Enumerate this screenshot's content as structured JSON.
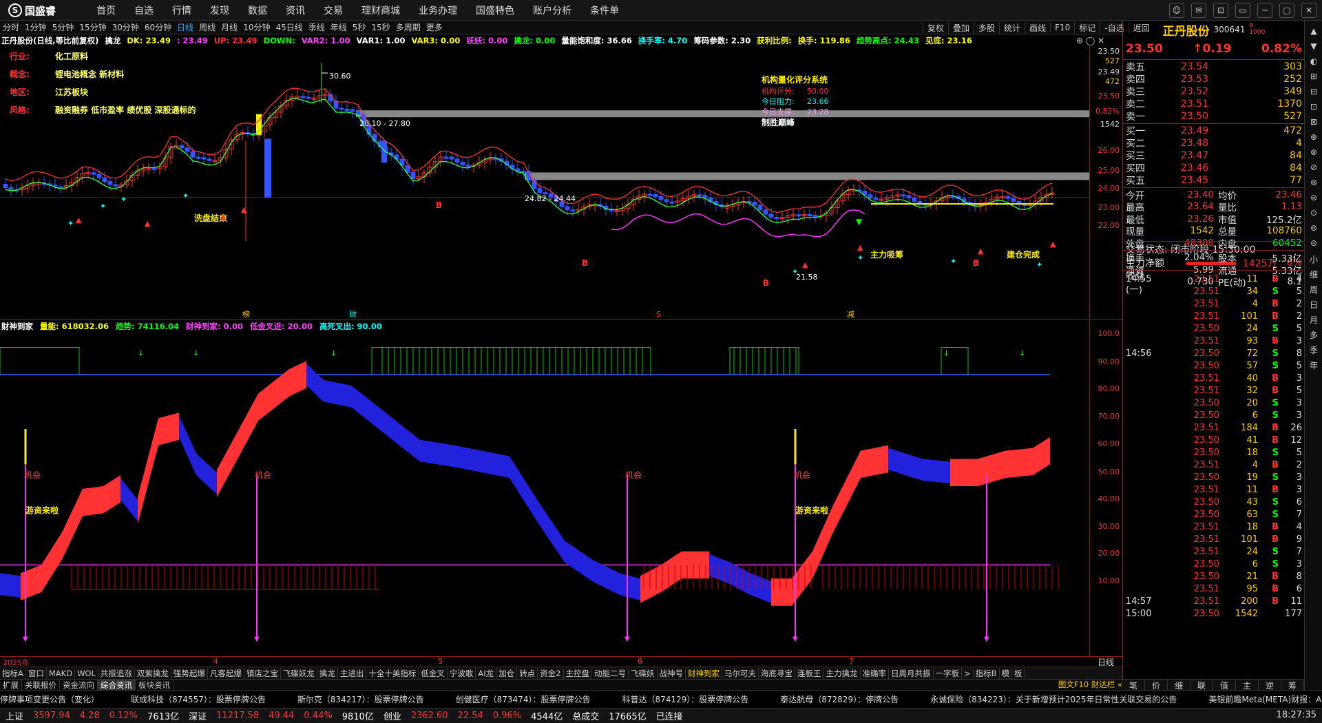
{
  "brand": {
    "name": "国盛睿"
  },
  "menu": [
    "首页",
    "自选",
    "行情",
    "发现",
    "数据",
    "资讯",
    "交易",
    "理财商城",
    "业务办理",
    "国盛特色",
    "账户分析",
    "条件单"
  ],
  "window_controls": [
    "☺",
    "✉",
    "⊡",
    "▭",
    "─",
    "▢",
    "✕"
  ],
  "periods": [
    "分时",
    "1分钟",
    "5分钟",
    "15分钟",
    "30分钟",
    "60分钟",
    "日线",
    "周线",
    "月线",
    "10分钟",
    "45日线",
    "季线",
    "年线",
    "5秒",
    "15秒",
    "多周期",
    "更多"
  ],
  "active_period": "日线",
  "right_tools": [
    "复权",
    "叠加",
    "多股",
    "统计",
    "画线",
    "F10",
    "标记",
    "-自选",
    "返回"
  ],
  "chart_info": [
    {
      "t": "正丹股份(日线,等比前复权)",
      "c": "#ffffff"
    },
    {
      "t": "擒龙",
      "c": "#ffffff"
    },
    {
      "t": "DK: 23.49",
      "c": "#ffff00"
    },
    {
      "t": ": 23.49",
      "c": "#ff44ff"
    },
    {
      "t": "UP: 23.49",
      "c": "#ff3333"
    },
    {
      "t": "DOWN: ",
      "c": "#00ff00"
    },
    {
      "t": "VAR2: 1.00",
      "c": "#ff44ff"
    },
    {
      "t": "VAR1: 1.00",
      "c": "#ffffff"
    },
    {
      "t": "VAR3: 0.00",
      "c": "#ffff00"
    },
    {
      "t": "妖妖: 0.00",
      "c": "#ff44ff"
    },
    {
      "t": "擒龙: 0.00",
      "c": "#00ff00"
    },
    {
      "t": "量能饱和度: 36.66",
      "c": "#ffffff"
    },
    {
      "t": "换手率: 4.70",
      "c": "#00ffff"
    },
    {
      "t": "筹码参数: 2.30",
      "c": "#ffffff"
    },
    {
      "t": "获利比例: ",
      "c": "#ffff00"
    },
    {
      "t": "换手: 119.86",
      "c": "#ffff00"
    },
    {
      "t": "趋势高点: 24.43",
      "c": "#00ff00"
    },
    {
      "t": "见底: 23.16",
      "c": "#ffff00"
    }
  ],
  "close_buttons": "⊕ ◯ ✕",
  "stock_tags": [
    {
      "k": "行业:",
      "v": "化工原料"
    },
    {
      "k": "概念:",
      "v": "锂电池概念 新材料"
    },
    {
      "k": "地区:",
      "v": "江苏板块"
    },
    {
      "k": "风格:",
      "v": "融资融券 低市盈率 绩优股 深股通标的"
    }
  ],
  "score_box": {
    "title": "机构量化评分系统",
    "lines": [
      {
        "k": "机构评分:",
        "v": "50.00",
        "c": "#ff3333"
      },
      {
        "k": "今日阻力:",
        "v": "23.66",
        "c": "#00ffff"
      },
      {
        "k": "今日支撑:",
        "v": "23.28",
        "c": "#ff99ff"
      }
    ],
    "footer": "制胜巅峰"
  },
  "annotations": {
    "high": "30.60",
    "zone1": "28.10 - 27.80",
    "zone2": "24.82 - 24.44",
    "low": "21.58",
    "wash": "洗盘结束",
    "main_absorb": "主力吸筹",
    "build_done": "建仓完成",
    "b": "B",
    "s": "S",
    "bang": "榜",
    "cai": "财",
    "jian": "减"
  },
  "main_axis": {
    "top_labels": [
      "23.50",
      "527",
      "23.49",
      "472",
      "23.50",
      "0.82%",
      "1542"
    ],
    "prices": [
      "26.00",
      "25.00",
      "24.00",
      "23.00",
      "22.00"
    ]
  },
  "indicator_info": [
    {
      "t": "财神到家",
      "c": "#ffffff"
    },
    {
      "t": "量能: 618032.06",
      "c": "#ffff00"
    },
    {
      "t": "趋势: 74116.04",
      "c": "#00ff00"
    },
    {
      "t": "财神到家: 0.00",
      "c": "#ff44ff"
    },
    {
      "t": "低金叉进: 20.00",
      "c": "#ff44ff"
    },
    {
      "t": "高死叉出: 90.00",
      "c": "#00ffff"
    }
  ],
  "ind_axis": [
    "100.0",
    "90.00",
    "80.00",
    "70.00",
    "60.00",
    "50.00",
    "40.00",
    "30.00",
    "20.00",
    "10.00"
  ],
  "ind_labels": {
    "chance": "机会",
    "fund": "游资来啦"
  },
  "dates": [
    "2025年",
    "4",
    "5",
    "6",
    "7"
  ],
  "day_label": "日线",
  "indicator_tabs": [
    "指标A",
    "窗口",
    "MAKD",
    "WOL",
    "共振追涨",
    "双紫擒龙",
    "强势起爆",
    "凡客起爆",
    "镇店之宝",
    "飞碟妖龙",
    "擒龙",
    "主进出",
    "十全十美指标",
    "低金叉",
    "宁波敢",
    "AI龙",
    "加仓",
    "转点",
    "资金2",
    "主控盘",
    "动能二号",
    "飞碟妖",
    "战神号",
    "财神到家",
    "马尔可夫",
    "海底寻宝",
    "连板王",
    "主力擒龙",
    "准确率",
    "日周月共振",
    "一字板",
    ">",
    "指标B",
    "模",
    "板"
  ],
  "active_indicator": "财神到家",
  "sub_tabs": [
    "扩展",
    "关联报价",
    "资金流向",
    "综合资讯",
    "板块资讯"
  ],
  "active_sub": "综合资讯",
  "sub_right": "图文F10 财达栏 «",
  "ticker": [
    "停牌事项变更公告（变化）",
    "联成科技（874557）：股票停牌公告",
    "斯尔克（834217）：股票停牌公告",
    "创健医疗（873474）：股票停牌公告",
    "科普达（874129）：股票停牌公告",
    "泰达航母（872829）：停牌公告",
    "永诚保险（834223）：关于新增预计2025年日常性关联交易的公告",
    "美银前瞻Meta(META)财报：AI加持广告县"
  ],
  "status": [
    {
      "t": "上证",
      "c": "#ffffff"
    },
    {
      "t": "3597.94",
      "c": "#ff3333"
    },
    {
      "t": "4.28",
      "c": "#ff3333"
    },
    {
      "t": "0.12%",
      "c": "#ff3333"
    },
    {
      "t": "7613亿",
      "c": "#ffffff"
    },
    {
      "t": "深证",
      "c": "#ffffff"
    },
    {
      "t": "11217.58",
      "c": "#ff3333"
    },
    {
      "t": "49.44",
      "c": "#ff3333"
    },
    {
      "t": "0.44%",
      "c": "#ff3333"
    },
    {
      "t": "9810亿",
      "c": "#ffffff"
    },
    {
      "t": "创业",
      "c": "#ffffff"
    },
    {
      "t": "2362.60",
      "c": "#ff3333"
    },
    {
      "t": "22.54",
      "c": "#ff3333"
    },
    {
      "t": "0.96%",
      "c": "#ff3333"
    },
    {
      "t": "4544亿",
      "c": "#ffffff"
    },
    {
      "t": "总成交",
      "c": "#ffffff"
    },
    {
      "t": "17665亿",
      "c": "#ffffff"
    },
    {
      "t": "已连接",
      "c": "#ffffff"
    }
  ],
  "clock": "18:27:35",
  "panel": {
    "name": "正丹股份",
    "code": "300641",
    "price": "23.50",
    "change": "↑0.19",
    "pct": "0.82%",
    "asks": [
      {
        "l": "卖五",
        "p": "23.54",
        "v": "303"
      },
      {
        "l": "卖四",
        "p": "23.53",
        "v": "252"
      },
      {
        "l": "卖三",
        "p": "23.52",
        "v": "349"
      },
      {
        "l": "卖二",
        "p": "23.51",
        "v": "1370"
      },
      {
        "l": "卖一",
        "p": "23.50",
        "v": "527"
      }
    ],
    "bids": [
      {
        "l": "买一",
        "p": "23.49",
        "v": "472"
      },
      {
        "l": "买二",
        "p": "23.48",
        "v": "4"
      },
      {
        "l": "买三",
        "p": "23.47",
        "v": "84"
      },
      {
        "l": "买四",
        "p": "23.46",
        "v": "84"
      },
      {
        "l": "买五",
        "p": "23.45",
        "v": "77"
      }
    ],
    "quote": [
      {
        "a": "今开",
        "b": "23.40",
        "bc": "#ff3333",
        "c": "均价",
        "d": "23.46",
        "dc": "#ff3333"
      },
      {
        "a": "最高",
        "b": "23.64",
        "bc": "#ff3333",
        "c": "量比",
        "d": "1.13",
        "dc": "#ff3333"
      },
      {
        "a": "最低",
        "b": "23.26",
        "bc": "#ff3333",
        "c": "市值",
        "d": "125.2亿",
        "dc": "#dddddd"
      },
      {
        "a": "现量",
        "b": "1542",
        "bc": "#ffcc00",
        "c": "总量",
        "d": "108760",
        "dc": "#ffcc00"
      },
      {
        "a": "外盘",
        "b": "48308",
        "bc": "#ff3333",
        "c": "内盘",
        "d": "60452",
        "dc": "#00ff00"
      },
      {
        "a": "换手",
        "b": "2.04%",
        "bc": "#dddddd",
        "c": "股本",
        "d": "5.33亿",
        "dc": "#dddddd"
      },
      {
        "a": "净资",
        "b": "5.99",
        "bc": "#dddddd",
        "c": "流通",
        "d": "5.33亿",
        "dc": "#dddddd"
      },
      {
        "a": "收益(一)",
        "b": "0.730",
        "bc": "#dddddd",
        "c": "PE(动)",
        "d": "8.1",
        "dc": "#dddddd"
      }
    ],
    "trade_status": "交易状态: 闭市阶段 15:30:00",
    "net_label": "主力净额",
    "net_value": "1425万",
    "net_pct": "6%",
    "ticks": [
      {
        "t": "14:55",
        "p": "23.51",
        "v": "11",
        "s": "B",
        "n": "4"
      },
      {
        "t": "",
        "p": "23.51",
        "v": "34",
        "s": "S",
        "n": "5"
      },
      {
        "t": "",
        "p": "23.51",
        "v": "4",
        "s": "B",
        "n": "2"
      },
      {
        "t": "",
        "p": "23.51",
        "v": "101",
        "s": "B",
        "n": "2"
      },
      {
        "t": "",
        "p": "23.50",
        "v": "24",
        "s": "S",
        "n": "5"
      },
      {
        "t": "",
        "p": "23.51",
        "v": "93",
        "s": "B",
        "n": "3"
      },
      {
        "t": "14:56",
        "p": "23.50",
        "v": "72",
        "s": "S",
        "n": "8"
      },
      {
        "t": "",
        "p": "23.50",
        "v": "57",
        "s": "S",
        "n": "5"
      },
      {
        "t": "",
        "p": "23.51",
        "v": "40",
        "s": "B",
        "n": "3"
      },
      {
        "t": "",
        "p": "23.51",
        "v": "32",
        "s": "B",
        "n": "5"
      },
      {
        "t": "",
        "p": "23.50",
        "v": "20",
        "s": "S",
        "n": "3"
      },
      {
        "t": "",
        "p": "23.50",
        "v": "6",
        "s": "S",
        "n": "3"
      },
      {
        "t": "",
        "p": "23.51",
        "v": "184",
        "s": "B",
        "n": "26"
      },
      {
        "t": "",
        "p": "23.50",
        "v": "41",
        "s": "B",
        "n": "12"
      },
      {
        "t": "",
        "p": "23.50",
        "v": "18",
        "s": "S",
        "n": "5"
      },
      {
        "t": "",
        "p": "23.51",
        "v": "4",
        "s": "B",
        "n": "2"
      },
      {
        "t": "",
        "p": "23.50",
        "v": "19",
        "s": "S",
        "n": "3"
      },
      {
        "t": "",
        "p": "23.51",
        "v": "11",
        "s": "B",
        "n": "3"
      },
      {
        "t": "",
        "p": "23.50",
        "v": "43",
        "s": "S",
        "n": "6"
      },
      {
        "t": "",
        "p": "23.50",
        "v": "63",
        "s": "S",
        "n": "7"
      },
      {
        "t": "",
        "p": "23.51",
        "v": "18",
        "s": "B",
        "n": "4"
      },
      {
        "t": "",
        "p": "23.51",
        "v": "101",
        "s": "B",
        "n": "9"
      },
      {
        "t": "",
        "p": "23.51",
        "v": "24",
        "s": "S",
        "n": "7"
      },
      {
        "t": "",
        "p": "23.50",
        "v": "6",
        "s": "S",
        "n": "3"
      },
      {
        "t": "",
        "p": "23.50",
        "v": "21",
        "s": "B",
        "n": "8"
      },
      {
        "t": "",
        "p": "23.51",
        "v": "95",
        "s": "B",
        "n": "6"
      },
      {
        "t": "14:57",
        "p": "23.51",
        "v": "200",
        "s": "B",
        "n": "11"
      },
      {
        "t": "15:00",
        "p": "23.50",
        "v": "1542",
        "s": "",
        "n": "177"
      }
    ],
    "bottom_tabs": [
      "笔",
      "价",
      "细",
      "联",
      "值",
      "主",
      "逆",
      "筹"
    ]
  },
  "vtabs": [
    "▲",
    "▼",
    "◐",
    "⊞",
    "⊟",
    "⊡",
    "⊠",
    "⊕",
    "⊗",
    "⊘",
    "⊛",
    "⊜",
    "⊙",
    "⊚",
    "⊝",
    "小",
    "细",
    "周",
    "日",
    "月",
    "多",
    "季",
    "年"
  ]
}
